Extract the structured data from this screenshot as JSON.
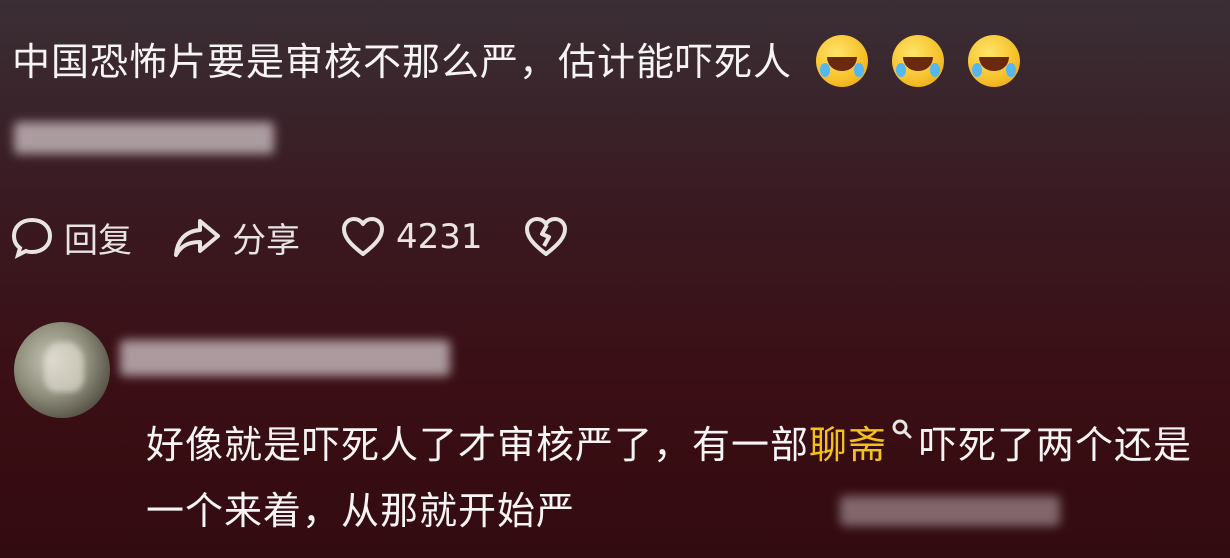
{
  "comment": {
    "text": "中国恐怖片要是审核不那么严，估计能吓死人",
    "emojis": [
      "laugh-cry-emoji",
      "laugh-cry-emoji",
      "laugh-cry-emoji"
    ]
  },
  "actions": {
    "reply_label": "回复",
    "share_label": "分享",
    "like_count": "4231"
  },
  "reply": {
    "text_before": "好像就是吓死人了才审核严了，有一部",
    "highlight": "聊斋",
    "text_after": "吓死了两个还是一个来着，从那就开始严"
  },
  "colors": {
    "highlight": "#f2c21b",
    "background": "#3a0e14"
  }
}
